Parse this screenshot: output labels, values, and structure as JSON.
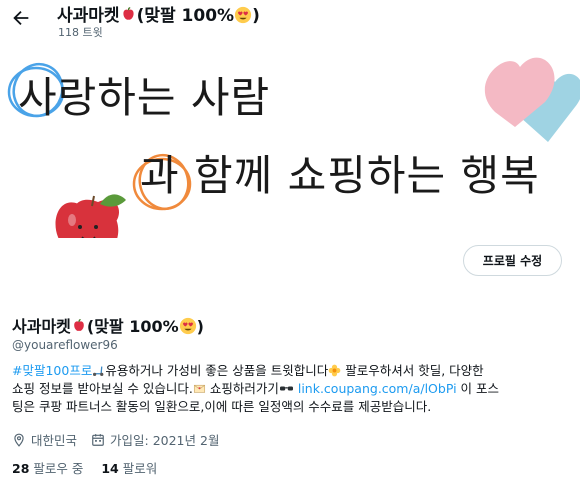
{
  "header": {
    "back_icon": "arrow-left-icon",
    "title_text": "사과마켓",
    "title_suffix": "(맞팔 100%",
    "title_end": ")",
    "tweet_count": "118 트윗"
  },
  "banner": {
    "line1": "사랑하는 사람",
    "line2": "과 함께 쇼핑하는 행복",
    "colors": {
      "circle_blue": "#4aa3e8",
      "circle_orange": "#f08a3c",
      "heart_pink": "#f4b9c4",
      "heart_blue": "#9fd3e3",
      "apple_red": "#d8323c",
      "leaf_green": "#5a9a3a"
    }
  },
  "profile": {
    "edit_button": "프로필 수정",
    "name_text": "사과마켓",
    "name_suffix": "(맞팔 100%",
    "name_end": ")",
    "handle": "@youareflower96",
    "bio": {
      "hashtag": "#맞팔100프로",
      "part1": "유용하거나 가성비 좋은 상품을 트윗합니다",
      "part2": " 팔로우하셔서 핫딜, 다양한",
      "part3": "쇼핑 정보를 받아보실 수 있습니다.",
      "part4": " 쇼핑하러가기",
      "link": "link.coupang.com/a/lObPi",
      "part5": " 이 포스",
      "part6": "팅은 쿠팡 파트너스 활동의 일환으로,이에 따른 일정액의 수수료를 제공받습니다."
    },
    "location": "대한민국",
    "joined": "가입일: 2021년 2월",
    "following_count": "28",
    "following_label": "팔로우 중",
    "followers_count": "14",
    "followers_label": "팔로워"
  },
  "icons": {
    "location": "location-pin-icon",
    "calendar": "calendar-icon"
  }
}
